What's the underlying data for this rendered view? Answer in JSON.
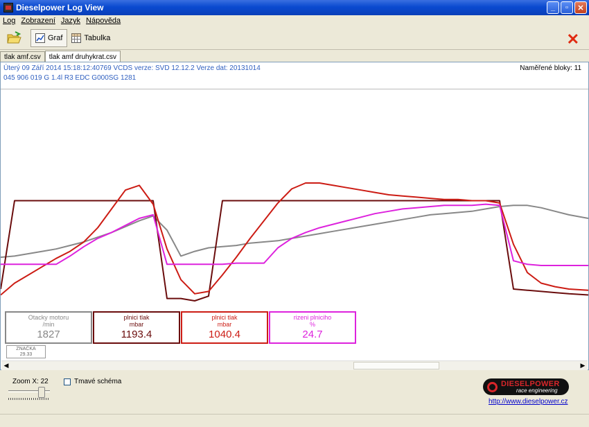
{
  "window": {
    "title": "Dieselpower Log View",
    "buttons": [
      "minimize",
      "maximize",
      "close"
    ]
  },
  "menu": [
    {
      "label": "Log"
    },
    {
      "label": "Zobrazení"
    },
    {
      "label": "Jazyk"
    },
    {
      "label": "Nápověda"
    }
  ],
  "toolbar": {
    "open_icon": "folder-open-icon",
    "graph_label": "Graf",
    "table_label": "Tabulka",
    "close_icon": "close-x-icon",
    "close_color": "#e02a10"
  },
  "tabs": [
    {
      "label": "tlak amf.csv",
      "active": false
    },
    {
      "label": "tlak amf druhykrat.csv",
      "active": true
    }
  ],
  "info": {
    "line1": "Úterý 09 Září 2014 15:18:12:40769 VCDS verze: SVD 12.12.2 Verze dat: 20131014",
    "line2": "045 906 019 G  1.4l R3 EDC G000SG  1281",
    "blocks": "Naměřené bloky: 11",
    "color": "#3060c0"
  },
  "gauges": [
    {
      "name": "Otacky motoru",
      "unit": "/min",
      "value": "1827",
      "color": "#888888"
    },
    {
      "name": "plnici tlak",
      "unit": "mbar",
      "value": "1193.4",
      "color": "#6a0c0c"
    },
    {
      "name": "plnici tlak",
      "unit": "mbar",
      "value": "1040.4",
      "color": "#cc1c14"
    },
    {
      "name": "rizeni plniciho",
      "unit": "%",
      "value": "24.7",
      "color": "#dd22dd"
    }
  ],
  "marker": {
    "label": "ZNAČKA",
    "value": "29.33"
  },
  "chart_data": {
    "type": "line",
    "x": [
      0,
      20,
      40,
      60,
      80,
      100,
      120,
      140,
      160,
      180,
      200,
      220,
      240,
      260,
      280,
      300,
      320,
      340,
      360,
      380,
      400,
      420,
      440,
      460,
      480,
      500,
      520,
      540,
      560,
      580,
      600,
      620,
      640,
      660,
      680,
      700,
      720,
      740,
      760,
      780,
      800,
      820,
      848
    ],
    "series": [
      {
        "color": "#888888",
        "values": [
          0.27,
          0.28,
          0.3,
          0.32,
          0.34,
          0.37,
          0.4,
          0.44,
          0.48,
          0.53,
          0.58,
          0.62,
          0.5,
          0.28,
          0.32,
          0.35,
          0.36,
          0.37,
          0.39,
          0.4,
          0.41,
          0.43,
          0.45,
          0.47,
          0.49,
          0.51,
          0.53,
          0.55,
          0.57,
          0.59,
          0.61,
          0.63,
          0.64,
          0.65,
          0.66,
          0.68,
          0.7,
          0.71,
          0.71,
          0.69,
          0.66,
          0.63,
          0.6
        ]
      },
      {
        "color": "#6a0c0c",
        "values": [
          0.0,
          0.75,
          0.75,
          0.75,
          0.75,
          0.75,
          0.75,
          0.75,
          0.75,
          0.75,
          0.75,
          0.75,
          -0.08,
          -0.08,
          -0.1,
          -0.06,
          0.75,
          0.75,
          0.75,
          0.75,
          0.75,
          0.75,
          0.75,
          0.75,
          0.75,
          0.75,
          0.75,
          0.75,
          0.75,
          0.75,
          0.75,
          0.75,
          0.75,
          0.75,
          0.75,
          0.75,
          0.75,
          0.0,
          -0.01,
          -0.02,
          -0.03,
          -0.04,
          -0.05
        ]
      },
      {
        "color": "#cc1c14",
        "values": [
          -0.05,
          0.05,
          0.12,
          0.19,
          0.26,
          0.32,
          0.4,
          0.52,
          0.68,
          0.84,
          0.88,
          0.72,
          0.34,
          0.08,
          -0.04,
          -0.02,
          0.12,
          0.27,
          0.43,
          0.58,
          0.73,
          0.85,
          0.9,
          0.9,
          0.88,
          0.86,
          0.84,
          0.82,
          0.8,
          0.79,
          0.78,
          0.77,
          0.76,
          0.76,
          0.75,
          0.75,
          0.73,
          0.38,
          0.14,
          0.05,
          0.02,
          0.0,
          -0.01
        ]
      },
      {
        "color": "#dd22dd",
        "values": [
          0.21,
          0.21,
          0.21,
          0.21,
          0.21,
          0.28,
          0.36,
          0.43,
          0.48,
          0.54,
          0.6,
          0.63,
          0.21,
          0.21,
          0.21,
          0.21,
          0.21,
          0.22,
          0.22,
          0.22,
          0.35,
          0.43,
          0.48,
          0.52,
          0.55,
          0.58,
          0.61,
          0.64,
          0.66,
          0.68,
          0.69,
          0.7,
          0.71,
          0.71,
          0.71,
          0.72,
          0.71,
          0.24,
          0.21,
          0.2,
          0.2,
          0.2,
          0.2
        ]
      }
    ]
  },
  "bottom": {
    "zoom_label": "Zoom X: 22",
    "zoom_value": 22,
    "dark_scheme_label": "Tmavé schéma",
    "dark_scheme_checked": false,
    "logo_text": "DIESELPOWER",
    "logo_sub": "race engineering",
    "url": "http://www.dieselpower.cz"
  }
}
